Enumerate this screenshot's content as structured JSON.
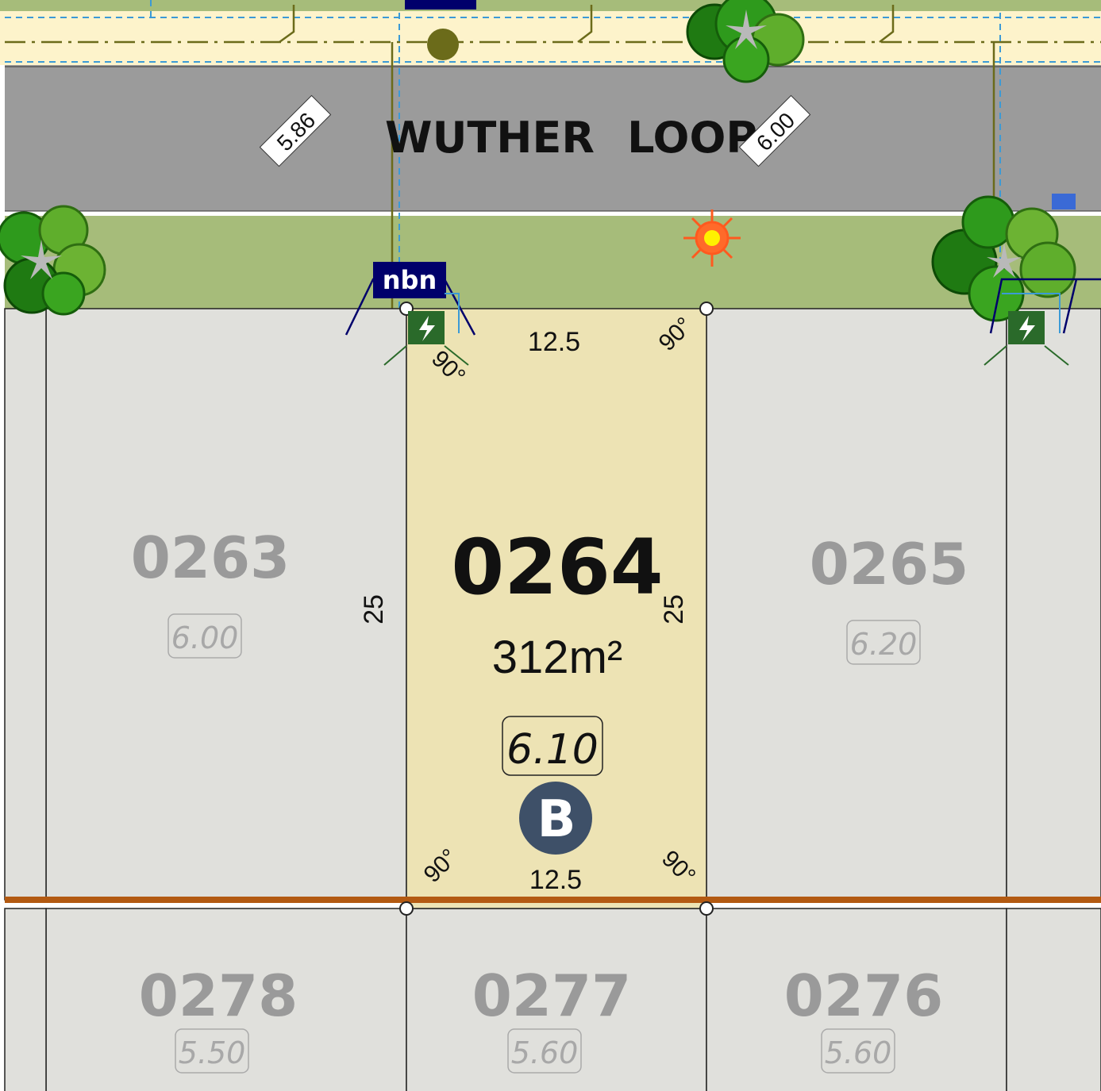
{
  "street": {
    "name_part_1": "WUTHER",
    "name_part_2": "LOOP",
    "width_left": "5.86",
    "width_right": "6.00"
  },
  "nbn_label": "nbn",
  "subject_lot": {
    "number": "0264",
    "area": "312m²",
    "level": "6.10",
    "badge": "B",
    "front_width": "12.5",
    "rear_width": "12.5",
    "left_depth": "25",
    "right_depth": "25",
    "angle_label": "90°"
  },
  "neighbour_lots": [
    {
      "number": "0263",
      "level": "6.00"
    },
    {
      "number": "0265",
      "level": "6.20"
    },
    {
      "number": "0278",
      "level": "5.50"
    },
    {
      "number": "0277",
      "level": "5.60"
    },
    {
      "number": "0276",
      "level": "5.60"
    }
  ],
  "colors": {
    "subject_lot_fill": "#ede3b4",
    "lot_fill": "#e0e0dc",
    "verge": "#a6bc7a",
    "road": "#9b9b9b",
    "footpath": "#fdf3cb",
    "rear_boundary": "#b35a12",
    "badge": "#3e5068",
    "nbn": "#00006b",
    "dashed_service": "#3b9ad6",
    "power_line": "#6b6b1a"
  },
  "icons": [
    "tree-icon",
    "street-light-icon",
    "power-pit-icon",
    "nbn-pit-icon",
    "survey-peg-icon"
  ]
}
